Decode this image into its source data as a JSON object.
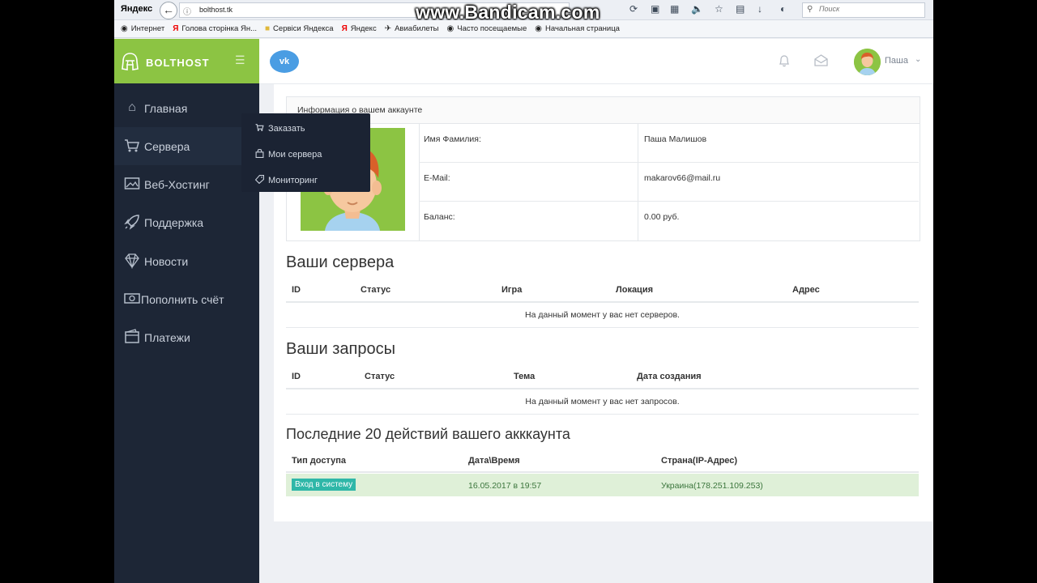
{
  "browser": {
    "brand": "Яндекс",
    "url": "bolthost.tk",
    "watermark": "www.Bandicam.com",
    "search_placeholder": "Поиск",
    "bookmarks": [
      {
        "label": "Интернет",
        "icon": "globe-icon"
      },
      {
        "label": "Голова сторінка Ян...",
        "icon": "yandex-icon"
      },
      {
        "label": "Сервiси Яндекса",
        "icon": "folder-icon"
      },
      {
        "label": "Яндекс",
        "icon": "yandex-icon"
      },
      {
        "label": "Авиабилеты",
        "icon": "plane-icon"
      },
      {
        "label": "Часто посещаемые",
        "icon": "globe-icon"
      },
      {
        "label": "Начальная страница",
        "icon": "globe-icon"
      }
    ]
  },
  "sidebar": {
    "brand": "BOLTHOST",
    "brand_color": "#8cc443",
    "items": [
      {
        "label": "Главная",
        "icon": "home-icon"
      },
      {
        "label": "Сервера",
        "icon": "cart-icon",
        "active": true
      },
      {
        "label": "Веб-Хостинг",
        "icon": "image-icon"
      },
      {
        "label": "Поддержка",
        "icon": "rocket-icon"
      },
      {
        "label": "Новости",
        "icon": "diamond-icon"
      },
      {
        "label": "Пополнить счёт",
        "icon": "money-icon"
      },
      {
        "label": "Платежи",
        "icon": "wallet-icon"
      }
    ],
    "submenu": [
      {
        "label": "Заказать",
        "icon": "cart-icon"
      },
      {
        "label": "Мои сервера",
        "icon": "bag-icon"
      },
      {
        "label": "Мониторинг",
        "icon": "tag-icon"
      }
    ]
  },
  "header": {
    "vk_label": "vk",
    "user_name": "Паша"
  },
  "account": {
    "title": "Информация о вашем аккаунте",
    "rows": [
      {
        "key": "Имя Фамилия:",
        "value": "Паша Малишов"
      },
      {
        "key": "E-Mail:",
        "value": "makarov66@mail.ru"
      },
      {
        "key": "Баланс:",
        "value": "0.00 руб."
      }
    ]
  },
  "servers": {
    "title": "Ваши сервера",
    "columns": [
      "ID",
      "Статус",
      "Игра",
      "Локация",
      "Адрес"
    ],
    "empty": "На данный момент у вас нет серверов."
  },
  "requests": {
    "title": "Ваши запросы",
    "columns": [
      "ID",
      "Статус",
      "Тема",
      "Дата создания"
    ],
    "empty": "На данный момент у вас нет запросов."
  },
  "activity": {
    "title": "Последние 20 действий вашего акккаунта",
    "columns": [
      "Тип доступа",
      "Дата\\Время",
      "Страна(IP-Адрес)"
    ],
    "rows": [
      {
        "type": "Вход в систему",
        "datetime": "16.05.2017 в 19:57",
        "country": "Украина(178.251.109.253)"
      }
    ]
  }
}
